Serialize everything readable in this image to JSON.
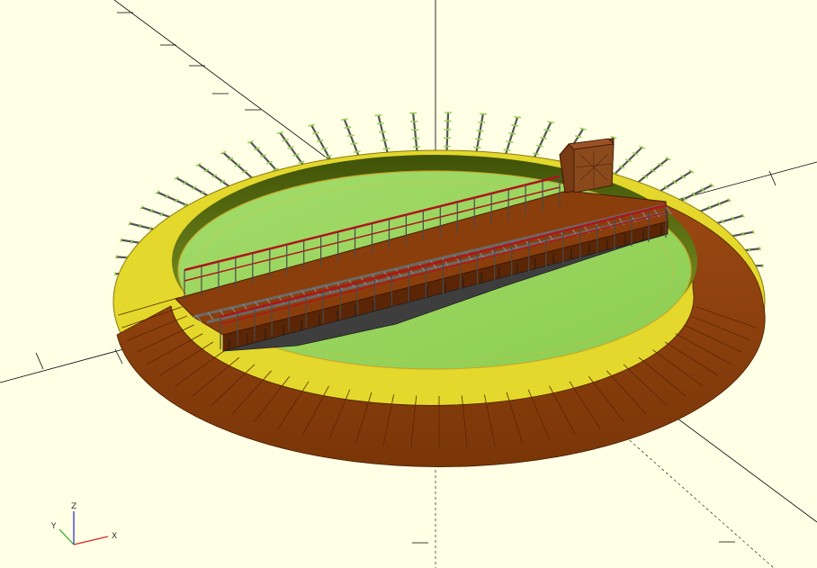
{
  "viewport": {
    "name": "3D view",
    "background_color": "#ffffe5"
  },
  "model": {
    "description_hidden": true,
    "colors": {
      "platform_green": "#94d35a",
      "pit_wall_dark": "#4e6410",
      "deck_brown": "#8a3e0b",
      "deck_brown_dark": "#5a2605",
      "rim_yellow": "#e3d82b",
      "rail_gray": "#555555",
      "tie_green": "#98d35a",
      "railing_red": "#b0151b",
      "cabin_brown": "#7a3a14"
    }
  },
  "axes_indicator": {
    "x_label": "X",
    "y_label": "Y",
    "z_label": "Z",
    "x_color": "#d22",
    "y_color": "#2a2",
    "z_color": "#22c"
  }
}
